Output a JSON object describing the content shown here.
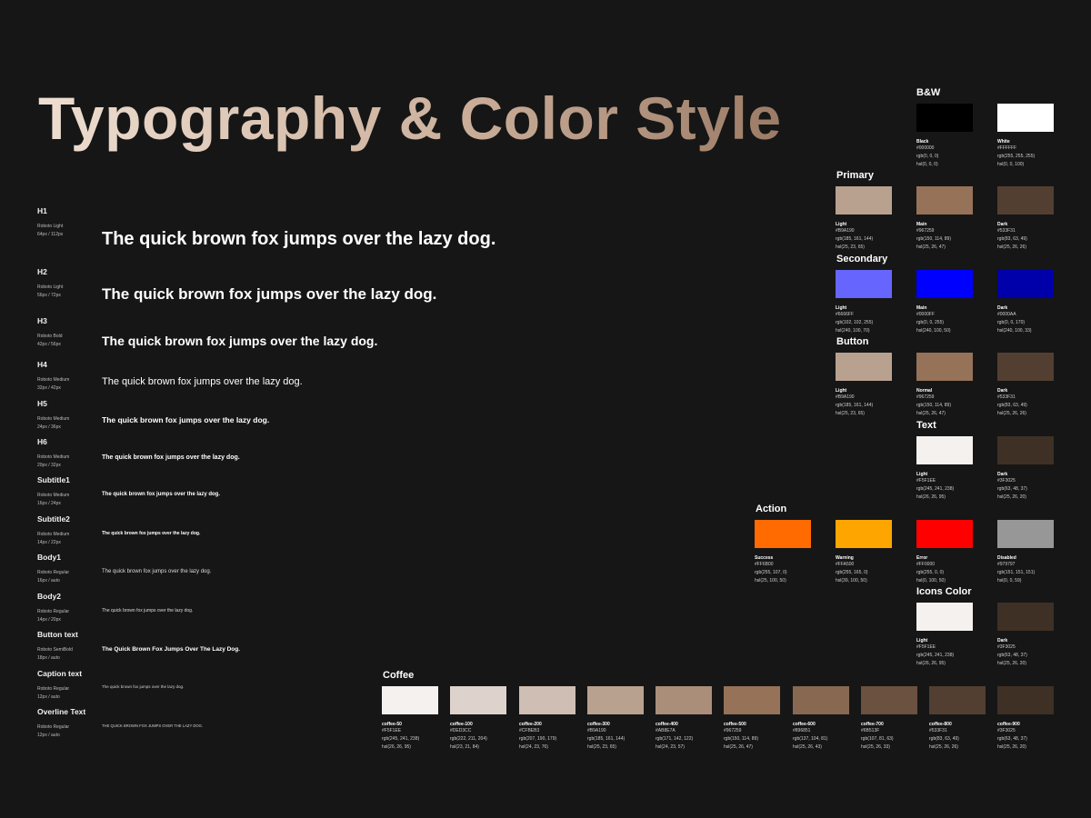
{
  "header": {
    "title": "Typography & Color Style"
  },
  "typography": [
    {
      "name": "H1",
      "font": "Roboto Light",
      "size": "64px / 112px",
      "sample": "The quick brown fox jumps over the lazy dog."
    },
    {
      "name": "H2",
      "font": "Roboto Light",
      "size": "56px / 72px",
      "sample": "The quick brown fox jumps over the lazy dog."
    },
    {
      "name": "H3",
      "font": "Roboto Bold",
      "size": "42px / 56px",
      "sample": "The quick brown fox jumps over the lazy dog."
    },
    {
      "name": "H4",
      "font": "Roboto Medium",
      "size": "32px / 42px",
      "sample": "The quick brown fox jumps over the lazy dog."
    },
    {
      "name": "H5",
      "font": "Roboto Medium",
      "size": "24px / 36px",
      "sample": "The quick brown fox jumps over the lazy dog."
    },
    {
      "name": "H6",
      "font": "Roboto Medium",
      "size": "20px / 32px",
      "sample": "The quick brown fox jumps over the lazy dog."
    },
    {
      "name": "Subtitle1",
      "font": "Roboto Medium",
      "size": "16px / 24px",
      "sample": "The quick brown fox jumps over the lazy dog."
    },
    {
      "name": "Subtitle2",
      "font": "Roboto Medium",
      "size": "14px / 22px",
      "sample": "The quick brown fox jumps over the lazy dog."
    },
    {
      "name": "Body1",
      "font": "Roboto Regular",
      "size": "16px / auto",
      "sample": "The quick brown fox jumps over the lazy dog."
    },
    {
      "name": "Body2",
      "font": "Roboto Regular",
      "size": "14px / 20px",
      "sample": "The quick brown fox jumps over the lazy dog."
    },
    {
      "name": "Button text",
      "font": "Roboto SemiBold",
      "size": "18px / auto",
      "sample": "The Quick Brown Fox Jumps Over The Lazy Dog."
    },
    {
      "name": "Caption text",
      "font": "Roboto Regular",
      "size": "12px / auto",
      "sample": "The quick brown fox jumps over the lazy dog."
    },
    {
      "name": "Overline Text",
      "font": "Roboto Regular",
      "size": "12px / auto",
      "sample": "THE QUICK BROWN FOX JUMPS OVER THE LAZY DOG."
    }
  ],
  "bw": {
    "title": "B&W",
    "swatches": [
      {
        "name": "Black",
        "hex": "#000000",
        "rgb": "rgb(0, 0, 0)",
        "hsl": "hsl(0, 0, 0)",
        "color": "#000000"
      },
      {
        "name": "White",
        "hex": "#FFFFFF",
        "rgb": "rgb(255, 255, 255)",
        "hsl": "hsl(0, 0, 100)",
        "color": "#FFFFFF"
      }
    ]
  },
  "primary": {
    "title": "Primary",
    "swatches": [
      {
        "name": "Light",
        "hex": "#B9A190",
        "rgb": "rgb(185, 161, 144)",
        "hsl": "hsl(25, 23, 65)",
        "color": "#B9A190"
      },
      {
        "name": "Main",
        "hex": "#967259",
        "rgb": "rgb(150, 114, 89)",
        "hsl": "hsl(25, 26, 47)",
        "color": "#967259"
      },
      {
        "name": "Dark",
        "hex": "#533F31",
        "rgb": "rgb(83, 63, 49)",
        "hsl": "hsl(25, 26, 26)",
        "color": "#533F31"
      }
    ]
  },
  "secondary": {
    "title": "Secondary",
    "swatches": [
      {
        "name": "Light",
        "hex": "#6666FF",
        "rgb": "rgb(102, 102, 255)",
        "hsl": "hsl(240, 100, 70)",
        "color": "#6666FF"
      },
      {
        "name": "Main",
        "hex": "#0000FF",
        "rgb": "rgb(0, 0, 255)",
        "hsl": "hsl(240, 100, 50)",
        "color": "#0000FF"
      },
      {
        "name": "Dark",
        "hex": "#0000AA",
        "rgb": "rgb(0, 0, 170)",
        "hsl": "hsl(240, 100, 33)",
        "color": "#0000AA"
      }
    ]
  },
  "button": {
    "title": "Button",
    "swatches": [
      {
        "name": "Light",
        "hex": "#B9A190",
        "rgb": "rgb(185, 161, 144)",
        "hsl": "hsl(25, 23, 65)",
        "color": "#B9A190"
      },
      {
        "name": "Normal",
        "hex": "#967259",
        "rgb": "rgb(150, 114, 89)",
        "hsl": "hsl(25, 26, 47)",
        "color": "#967259"
      },
      {
        "name": "Dark",
        "hex": "#533F31",
        "rgb": "rgb(83, 63, 49)",
        "hsl": "hsl(25, 26, 26)",
        "color": "#533F31"
      }
    ]
  },
  "text": {
    "title": "Text",
    "swatches": [
      {
        "name": "Light",
        "hex": "#F5F1EE",
        "rgb": "rgb(245, 241, 238)",
        "hsl": "hsl(26, 26, 95)",
        "color": "#F5F1EE"
      },
      {
        "name": "Dark",
        "hex": "#3F3025",
        "rgb": "rgb(63, 48, 37)",
        "hsl": "hsl(25, 26, 20)",
        "color": "#3F3025"
      }
    ]
  },
  "action": {
    "title": "Action",
    "swatches": [
      {
        "name": "Success",
        "hex": "#FF6B00",
        "rgb": "rgb(255, 107, 0)",
        "hsl": "hsl(25, 100, 50)",
        "color": "#FF6B00"
      },
      {
        "name": "Warning",
        "hex": "#FFA500",
        "rgb": "rgb(255, 165, 0)",
        "hsl": "hsl(39, 100, 50)",
        "color": "#FFA500"
      },
      {
        "name": "Error",
        "hex": "#FF0000",
        "rgb": "rgb(255, 0, 0)",
        "hsl": "hsl(0, 100, 50)",
        "color": "#FF0000"
      },
      {
        "name": "Disabled",
        "hex": "#979797",
        "rgb": "rgb(151, 151, 151)",
        "hsl": "hsl(0, 0, 59)",
        "color": "#979797"
      }
    ]
  },
  "icons": {
    "title": "Icons Color",
    "swatches": [
      {
        "name": "Light",
        "hex": "#F5F1EE",
        "rgb": "rgb(245, 241, 238)",
        "hsl": "hsl(26, 26, 95)",
        "color": "#F5F1EE"
      },
      {
        "name": "Dark",
        "hex": "#3F3025",
        "rgb": "rgb(63, 48, 37)",
        "hsl": "hsl(25, 26, 20)",
        "color": "#3F3025"
      }
    ]
  },
  "coffee": {
    "title": "Coffee",
    "swatches": [
      {
        "name": "coffee-50",
        "hex": "#F5F1EE",
        "rgb": "rgb(245, 241, 238)",
        "hsl": "hsl(26, 26, 95)",
        "color": "#F5F1EE"
      },
      {
        "name": "coffee-100",
        "hex": "#DED3CC",
        "rgb": "rgb(222, 211, 204)",
        "hsl": "hsl(23, 21, 84)",
        "color": "#DED3CC"
      },
      {
        "name": "coffee-200",
        "hex": "#CFBEB3",
        "rgb": "rgb(207, 190, 179)",
        "hsl": "hsl(24, 23, 76)",
        "color": "#CFBEB3"
      },
      {
        "name": "coffee-300",
        "hex": "#B9A190",
        "rgb": "rgb(185, 161, 144)",
        "hsl": "hsl(25, 23, 65)",
        "color": "#B9A190"
      },
      {
        "name": "coffee-400",
        "hex": "#AB8E7A",
        "rgb": "rgb(171, 142, 122)",
        "hsl": "hsl(24, 23, 57)",
        "color": "#AB8E7A"
      },
      {
        "name": "coffee-500",
        "hex": "#967259",
        "rgb": "rgb(150, 114, 89)",
        "hsl": "hsl(25, 26, 47)",
        "color": "#967259"
      },
      {
        "name": "coffee-600",
        "hex": "#896851",
        "rgb": "rgb(137, 104, 81)",
        "hsl": "hsl(25, 26, 43)",
        "color": "#896851"
      },
      {
        "name": "coffee-700",
        "hex": "#6B513F",
        "rgb": "rgb(107, 81, 63)",
        "hsl": "hsl(25, 26, 33)",
        "color": "#6B513F"
      },
      {
        "name": "coffee-800",
        "hex": "#533F31",
        "rgb": "rgb(83, 63, 49)",
        "hsl": "hsl(25, 26, 26)",
        "color": "#533F31"
      },
      {
        "name": "coffee-900",
        "hex": "#3F3025",
        "rgb": "rgb(63, 48, 37)",
        "hsl": "hsl(25, 26, 20)",
        "color": "#3F3025"
      }
    ]
  }
}
